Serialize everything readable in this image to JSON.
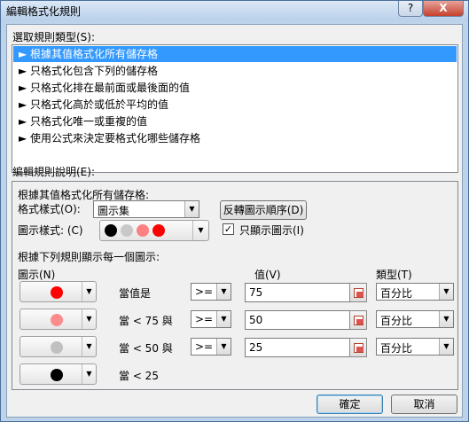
{
  "window": {
    "title": "編輯格式化規則",
    "help_label": "?",
    "close_label": "X"
  },
  "rule_type": {
    "label": "選取規則類型(S):",
    "items": [
      "► 根據其值格式化所有儲存格",
      "► 只格式化包含下列的儲存格",
      "► 只格式化排在最前面或最後面的值",
      "► 只格式化高於或低於平均的值",
      "► 只格式化唯一或重複的值",
      "► 使用公式來決定要格式化哪些儲存格"
    ]
  },
  "description": {
    "label": "編輯規則說明(E):",
    "heading": "根據其值格式化所有儲存格:",
    "format_style_label": "格式樣式(O):",
    "format_style_value": "圖示集",
    "reverse_label": "反轉圖示順序(D)",
    "icon_style_label": "圖示樣式: (C)",
    "icon_style_colors": [
      "#000000",
      "#c8c8c8",
      "#ff8080",
      "#ff0000"
    ],
    "show_icon_only_label": "只顯示圖示(I)",
    "show_icon_only_checked": true,
    "rule_heading": "根據下列規則顯示每一個圖示:",
    "col_icon": "圖示(N)",
    "col_value": "值(V)",
    "col_type": "類型(T)",
    "rows": [
      {
        "icon_color": "#ff0000",
        "condition": "當值是",
        "op": ">=",
        "value": "75",
        "type": "百分比"
      },
      {
        "icon_color": "#ff8c8c",
        "condition": "當 < 75 與",
        "op": ">=",
        "value": "50",
        "type": "百分比"
      },
      {
        "icon_color": "#c0c0c0",
        "condition": "當 < 50 與",
        "op": ">=",
        "value": "25",
        "type": "百分比"
      },
      {
        "icon_color": "#000000",
        "condition": "當 < 25"
      }
    ]
  },
  "buttons": {
    "ok": "確定",
    "cancel": "取消"
  }
}
